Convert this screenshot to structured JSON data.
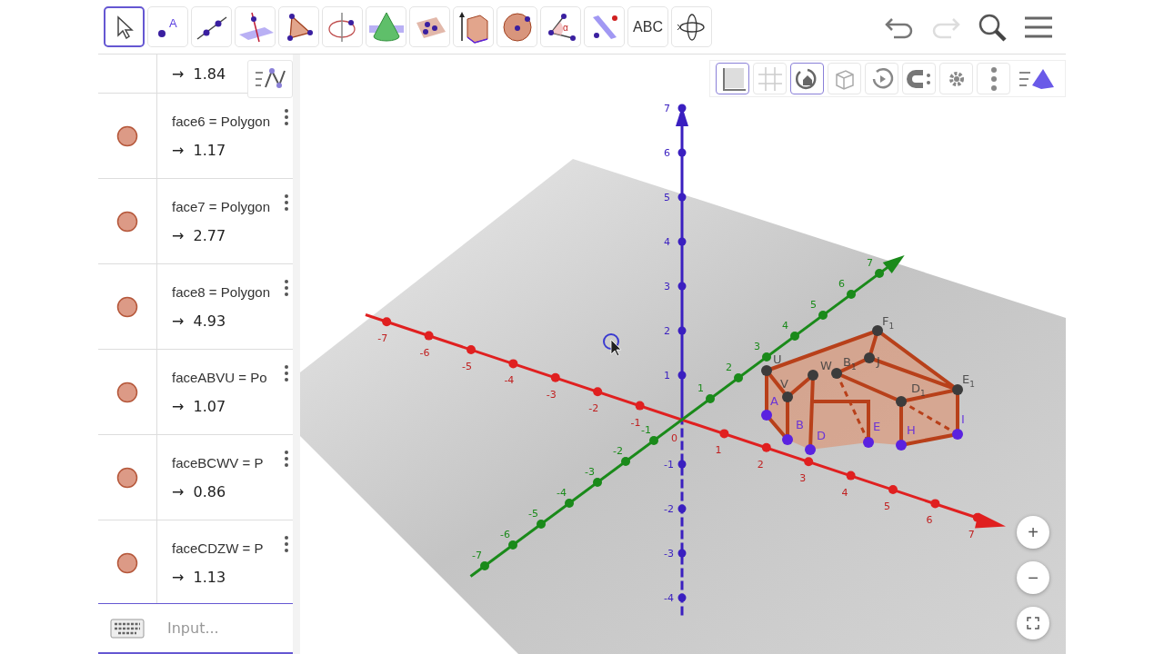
{
  "toolbar": {
    "tools": [
      {
        "kind": "move",
        "selected": true
      },
      {
        "kind": "point",
        "selected": false,
        "label": "A"
      },
      {
        "kind": "line",
        "selected": false
      },
      {
        "kind": "perpendicular",
        "selected": false
      },
      {
        "kind": "polygon",
        "selected": false
      },
      {
        "kind": "circle-axis",
        "selected": false
      },
      {
        "kind": "cone",
        "selected": false
      },
      {
        "kind": "plane",
        "selected": false
      },
      {
        "kind": "prism",
        "selected": false
      },
      {
        "kind": "sphere",
        "selected": false
      },
      {
        "kind": "angle",
        "selected": false,
        "label": "α"
      },
      {
        "kind": "reflect",
        "selected": false
      },
      {
        "kind": "text",
        "selected": false,
        "label": "ABC"
      },
      {
        "kind": "rotate",
        "selected": false
      }
    ],
    "history": [
      {
        "kind": "undo",
        "disabled": false
      },
      {
        "kind": "redo",
        "disabled": true
      }
    ],
    "actions": [
      {
        "kind": "search"
      },
      {
        "kind": "menu"
      }
    ]
  },
  "algebra": {
    "items": [
      {
        "value": "1.84"
      },
      {
        "definition": "face6 = Polygon",
        "value": "1.17",
        "visible": true
      },
      {
        "definition": "face7 = Polygon",
        "value": "2.77",
        "visible": true
      },
      {
        "definition": "face8 = Polygon",
        "value": "4.93",
        "visible": true
      },
      {
        "definition": "faceABVU = Po",
        "value": "1.07",
        "visible": true
      },
      {
        "definition": "faceBCWV = P",
        "value": "0.86",
        "visible": true
      },
      {
        "definition": "faceCDZW = P",
        "value": "1.13",
        "visible": true
      }
    ],
    "arrow": "→",
    "input": {
      "placeholder": "Input..."
    }
  },
  "style_bar": {
    "buttons": [
      {
        "kind": "axes",
        "selected": true
      },
      {
        "kind": "grid",
        "selected": false
      },
      {
        "kind": "home",
        "selected": true
      },
      {
        "kind": "view",
        "selected": false
      },
      {
        "kind": "spin",
        "selected": false
      },
      {
        "kind": "projection",
        "selected": false
      },
      {
        "kind": "settings",
        "selected": false
      },
      {
        "kind": "more",
        "selected": false
      }
    ]
  },
  "view3d": {
    "x_ticks": [
      "-7",
      "-6",
      "-5",
      "-4",
      "-3",
      "-2",
      "-1",
      "1",
      "2",
      "3",
      "4",
      "5",
      "6",
      "7"
    ],
    "y_ticks": [
      "-7",
      "-6",
      "-5",
      "-4",
      "-3",
      "-2",
      "-1",
      "1",
      "2",
      "3",
      "4",
      "5",
      "6",
      "7"
    ],
    "z_ticks": [
      "7",
      "6",
      "5",
      "4",
      "3",
      "2",
      "1",
      "-1",
      "-2",
      "-3",
      "-4"
    ],
    "origin": "0",
    "points": [
      {
        "label": "U",
        "color": "#3c3c3c"
      },
      {
        "label": "V",
        "color": "#3c3c3c"
      },
      {
        "label": "W",
        "color": "#3c3c3c"
      },
      {
        "label": "B",
        "subscript": "1",
        "color": "#3c3c3c"
      },
      {
        "label": "F",
        "subscript": "1",
        "color": "#3c3c3c"
      },
      {
        "label": "J",
        "color": "#3c3c3c"
      },
      {
        "label": "E",
        "subscript": "1",
        "color": "#3c3c3c"
      },
      {
        "label": "D",
        "subscript": "1",
        "color": "#3c3c3c"
      },
      {
        "label": "A",
        "color": "#5a22e0"
      },
      {
        "label": "B",
        "color": "#5a22e0"
      },
      {
        "label": "D",
        "color": "#5a22e0"
      },
      {
        "label": "E",
        "color": "#5a22e0"
      },
      {
        "label": "H",
        "color": "#5a22e0"
      },
      {
        "label": "I",
        "color": "#5a22e0"
      }
    ]
  },
  "zoom": [
    {
      "kind": "in",
      "label": "+"
    },
    {
      "kind": "out",
      "label": "−"
    },
    {
      "kind": "fullscreen"
    }
  ]
}
